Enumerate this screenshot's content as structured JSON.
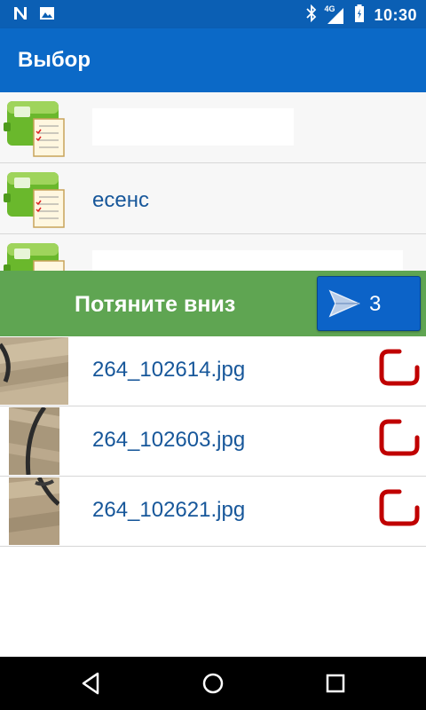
{
  "status_bar": {
    "time": "10:30",
    "network": "4G",
    "icons": [
      "n-notification-icon",
      "image-notification-icon",
      "bluetooth-icon",
      "signal-icon",
      "battery-icon"
    ]
  },
  "app_bar": {
    "title": "Выбор"
  },
  "categories": [
    {
      "label": "",
      "icon": "form-checklist-icon"
    },
    {
      "label": "есенс",
      "icon": "form-checklist-icon"
    },
    {
      "label": "",
      "icon": "form-checklist-icon"
    }
  ],
  "action_bar": {
    "pull_label": "Потяните вниз",
    "send_count": "3",
    "send_icon": "send-icon"
  },
  "files": [
    {
      "name": "264_102614.jpg",
      "selected": true
    },
    {
      "name": "264_102603.jpg",
      "selected": true
    },
    {
      "name": "264_102621.jpg",
      "selected": true
    }
  ],
  "nav": {
    "icons": [
      "back-icon",
      "home-icon",
      "recents-icon"
    ]
  },
  "colors": {
    "status_bar": "#0b5fb4",
    "app_bar": "#0b69c7",
    "green_bar": "#5fa552",
    "send_button": "#0c63c8",
    "link_text": "#17579a",
    "check_red": "#c00000"
  }
}
